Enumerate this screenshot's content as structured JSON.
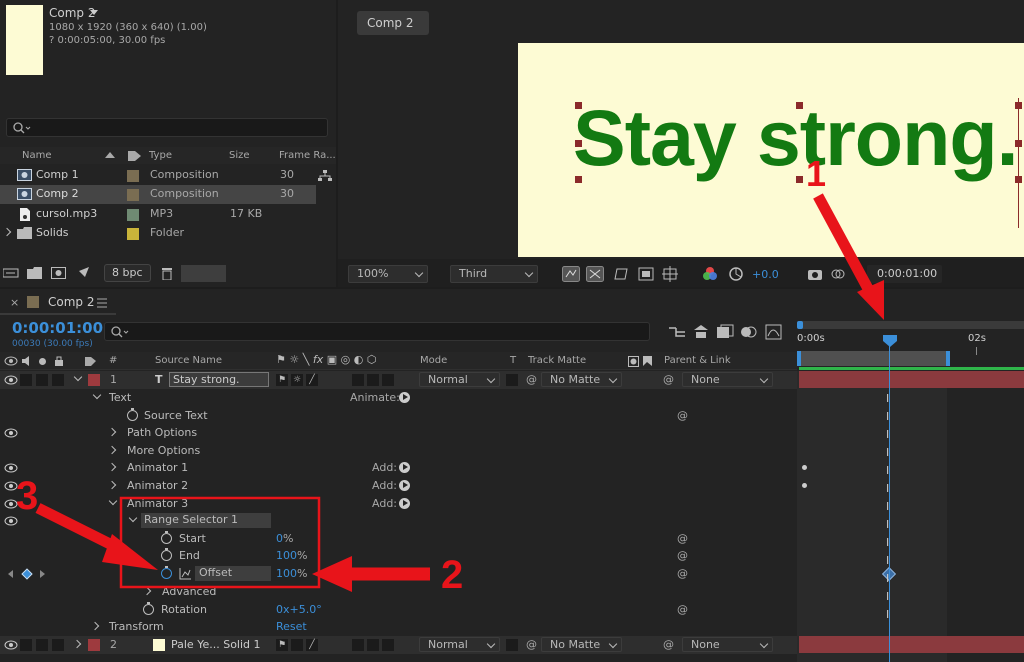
{
  "project": {
    "comp_name": "Comp 2",
    "comp_dims": "1080 x 1920  (360 x 640) (1.00)",
    "comp_duration": "? 0:00:05:00, 30.00 fps",
    "columns": {
      "name": "Name",
      "type": "Type",
      "size": "Size",
      "frame_rate": "Frame Ra..."
    },
    "items": [
      {
        "name": "Comp 1",
        "type": "Composition",
        "size": "",
        "fps": "30",
        "swatch": "#7a6d52"
      },
      {
        "name": "Comp 2",
        "type": "Composition",
        "size": "",
        "fps": "30",
        "swatch": "#7a6d52"
      },
      {
        "name": "cursol.mp3",
        "type": "MP3",
        "size": "17 KB",
        "fps": "",
        "swatch": "#6f8a73"
      },
      {
        "name": "Solids",
        "type": "Folder",
        "size": "",
        "fps": "",
        "swatch": "#c9b43a"
      }
    ],
    "bpc": "8 bpc"
  },
  "viewer": {
    "tab": "Comp 2",
    "canvas_text": "Stay strong.",
    "zoom": "100%",
    "resolution": "Third",
    "exposure": "+0.0",
    "timecode": "0:00:01:00",
    "canvas_bg": "#fdfbd4",
    "text_color": "#137a12"
  },
  "timeline": {
    "tab": "Comp 2",
    "timecode": "0:00:01:00",
    "frames": "00030 (30.00 fps)",
    "col_hash": "#",
    "col_source": "Source Name",
    "col_mode": "Mode",
    "col_t": "T",
    "col_matte": "Track Matte",
    "col_parent": "Parent & Link",
    "ruler": [
      "0:00s",
      "02s"
    ],
    "layer1": {
      "num": "1",
      "name": "Stay strong.",
      "mode": "Normal",
      "matte": "No Matte",
      "parent": "None"
    },
    "layer2": {
      "num": "2",
      "name": "Pale Ye... Solid 1",
      "mode": "Normal",
      "matte": "No Matte",
      "parent": "None"
    },
    "props": {
      "text": "Text",
      "animate": "Animate:",
      "source_text": "Source Text",
      "path_options": "Path Options",
      "more_options": "More Options",
      "animator1": "Animator 1",
      "animator2": "Animator 2",
      "animator3": "Animator 3",
      "add": "Add:",
      "range_selector": "Range Selector 1",
      "start": "Start",
      "start_val": "0",
      "end": "End",
      "end_val": "100",
      "offset": "Offset",
      "offset_val": "100",
      "pct": "%",
      "advanced": "Advanced",
      "rotation": "Rotation",
      "rotation_val": "0x+5.0°",
      "transform": "Transform",
      "reset": "Reset"
    }
  },
  "annotations": {
    "one": "1",
    "two": "2",
    "three": "3",
    "color": "#e8141a"
  }
}
